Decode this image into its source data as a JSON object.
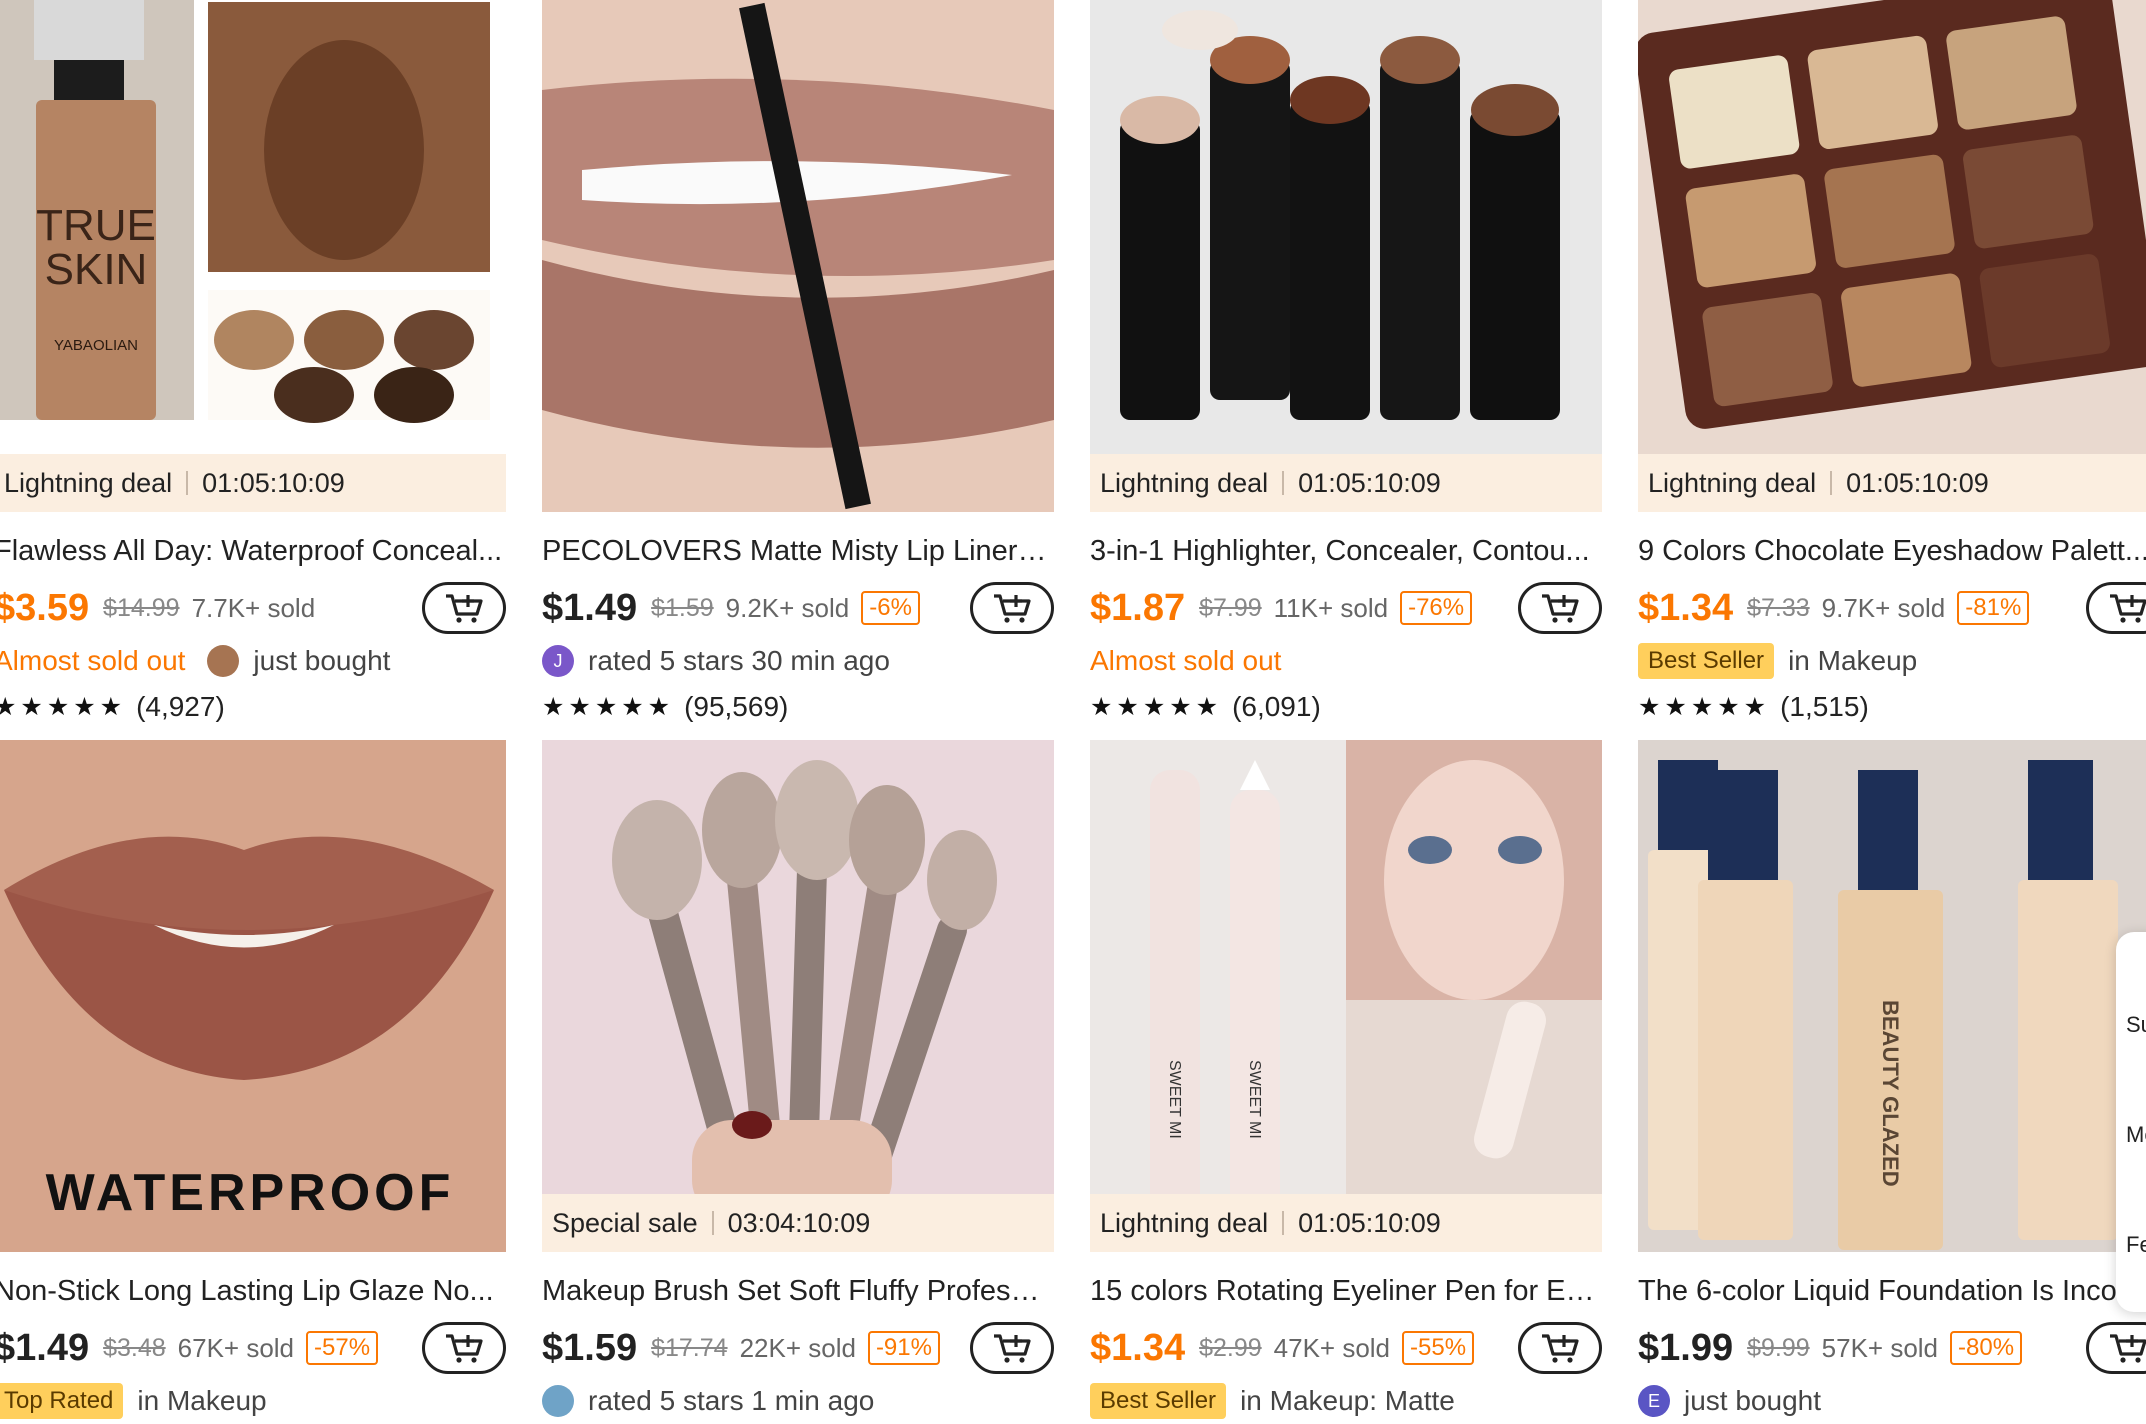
{
  "cards": [
    {
      "deal": {
        "label": "Lightning deal",
        "timer": "01:05:10:09"
      },
      "image_icon": "foundation-bottle-image",
      "image_text": {
        "brand1": "TRUE",
        "brand2": "SKIN",
        "maker": "YABAOLIAN"
      },
      "title": "Flawless All Day: Waterproof Conceal...",
      "price": "$3.59",
      "orig": "$14.99",
      "sold": "7.7K+ sold",
      "discount": "",
      "line2": {
        "almost": "Almost sold out",
        "text": "just bought"
      },
      "rating_count": "(4,927)",
      "accent": "#fb7701"
    },
    {
      "deal": null,
      "image_icon": "lip-liner-image",
      "title": "PECOLOVERS Matte Misty Lip Liner Li...",
      "price": "$1.49",
      "orig": "$1.59",
      "sold": "9.2K+ sold",
      "discount": "-6%",
      "line2": {
        "avatar": "J",
        "text": "rated 5 stars 30 min ago"
      },
      "rating_count": "(95,569)"
    },
    {
      "deal": {
        "label": "Lightning deal",
        "timer": "01:05:10:09"
      },
      "image_icon": "highlighter-sticks-image",
      "title": "3-in-1 Highlighter, Concealer, Contou...",
      "price": "$1.87",
      "orig": "$7.99",
      "sold": "11K+ sold",
      "discount": "-76%",
      "line2": {
        "almost": "Almost sold out"
      },
      "rating_count": "(6,091)"
    },
    {
      "deal": {
        "label": "Lightning deal",
        "timer": "01:05:10:09"
      },
      "image_icon": "eyeshadow-palette-image",
      "title": "9 Colors Chocolate Eyeshadow Palett...",
      "price": "$1.34",
      "orig": "$7.33",
      "sold": "9.7K+ sold",
      "discount": "-81%",
      "line2": {
        "badge": "Best Seller",
        "text": "in Makeup"
      },
      "rating_count": "(1,515)"
    },
    {
      "deal": null,
      "image_icon": "lip-glaze-image",
      "image_text": {
        "overlay": "WATERPROOF"
      },
      "title": "Non-Stick Long Lasting Lip Glaze No...",
      "price": "$1.49",
      "orig": "$3.48",
      "sold": "67K+ sold",
      "discount": "-57%",
      "line2": {
        "badge": "Top Rated",
        "text": "in Makeup"
      }
    },
    {
      "deal": {
        "label": "Special sale",
        "timer": "03:04:10:09"
      },
      "image_icon": "makeup-brush-set-image",
      "title": "Makeup Brush Set Soft Fluffy Professi...",
      "price": "$1.59",
      "orig": "$17.74",
      "sold": "22K+ sold",
      "discount": "-91%",
      "line2": {
        "avatar": "",
        "text": "rated 5 stars 1 min ago"
      }
    },
    {
      "deal": {
        "label": "Lightning deal",
        "timer": "01:05:10:09"
      },
      "image_icon": "eyeliner-pen-image",
      "image_text": {
        "pen1": "SWEET MI",
        "pen2": "SWEET MI"
      },
      "title": "15 colors Rotating Eyeliner Pen for Ey...",
      "price": "$1.34",
      "orig": "$2.99",
      "sold": "47K+ sold",
      "discount": "-55%",
      "line2": {
        "badge": "Best Seller",
        "text": "in Makeup: Matte"
      }
    },
    {
      "deal": null,
      "image_icon": "liquid-foundation-image",
      "image_text": {
        "label": "BEAUTY GLAZED"
      },
      "title": "The 6-color Liquid Foundation Is Inco",
      "price": "$1.99",
      "orig": "$9.99",
      "sold": "57K+ sold",
      "discount": "-80%",
      "line2": {
        "avatar": "E",
        "text": "just bought"
      }
    }
  ],
  "side_panel": {
    "items": [
      "Su",
      "Me",
      "Fe"
    ]
  },
  "icons": {
    "cart": "add-to-cart-icon",
    "star": "star-icon"
  },
  "colors": {
    "accent": "#fb7701",
    "deal_bg": "#fbeee0",
    "badge_bg": "#ffcf5c"
  }
}
